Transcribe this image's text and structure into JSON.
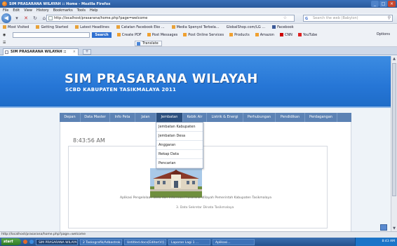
{
  "window": {
    "title": "SIM PRASARANA WILAYAH :: Home - Mozilla Firefox",
    "buttons": [
      "_",
      "□",
      "×"
    ]
  },
  "menu": [
    "File",
    "Edit",
    "View",
    "History",
    "Bookmarks",
    "Tools",
    "Help"
  ],
  "nav": {
    "url": "http://localhost/prasarana/home.php?page=welcome",
    "search_placeholder": "Search the web (Babylon)"
  },
  "bookmarks": [
    "Most Visited",
    "Getting Started",
    "Latest Headlines",
    "Catatan Facebook Eko ...",
    "Media Spenyol Terbela...",
    "GlobalShop.com/LG ...",
    "Facebook"
  ],
  "toolbar2": {
    "search_btn": "Search",
    "items": [
      "Create PDF",
      "Post Messages",
      "Post Online Services",
      "Products",
      "Amazon",
      "CNN",
      "YouTube"
    ],
    "options": "Options"
  },
  "toolbar3": {
    "translate": "Translate"
  },
  "tab": {
    "label": "SIM PRASARANA WILAYAH :: Home"
  },
  "site": {
    "title": "SIM PRASARANA WILAYAH",
    "subtitle": "SCBD KABUPATEN TASIKMALAYA 2011",
    "colors": {
      "banner": "#2676d6",
      "nav": "#5c82b4",
      "nav_active": "#2b4f7e"
    }
  },
  "navmenu": [
    "Depan",
    "Data Master",
    "Info Peta",
    "Jalan",
    "Jembatan",
    "Kebik Air",
    "Listrik & Energi",
    "Perhubungan",
    "Pendidikan",
    "Perdagangan"
  ],
  "dropdown": [
    "Jembatan Kabupaten",
    "Jembatan Desa",
    "Anggaran",
    "Rekap Data",
    "Pencarian"
  ],
  "content": {
    "time": "8:43:56 AM",
    "footer_line1": "Aplikasi Pengelolaan Data dan Informasi Prasarana Wilayah Pemerintah Kabupaten Tasikmalaya",
    "footer_line2": "3. Dato Sekretar Dinata Tasikmalaya"
  },
  "status": {
    "text": "http://localhost/prasarana/home.php?page=welcome"
  },
  "taskbar": {
    "start": "start",
    "tasks": [
      "SIM PRASARANA WILAYAH...",
      "2 Tasksgrafik/Adbastrok...",
      "Untitled.docx[Editor(V)]...",
      "Laporan Lagi 1 ...",
      "Aplikasi..."
    ],
    "clock": "8:43 AM"
  }
}
